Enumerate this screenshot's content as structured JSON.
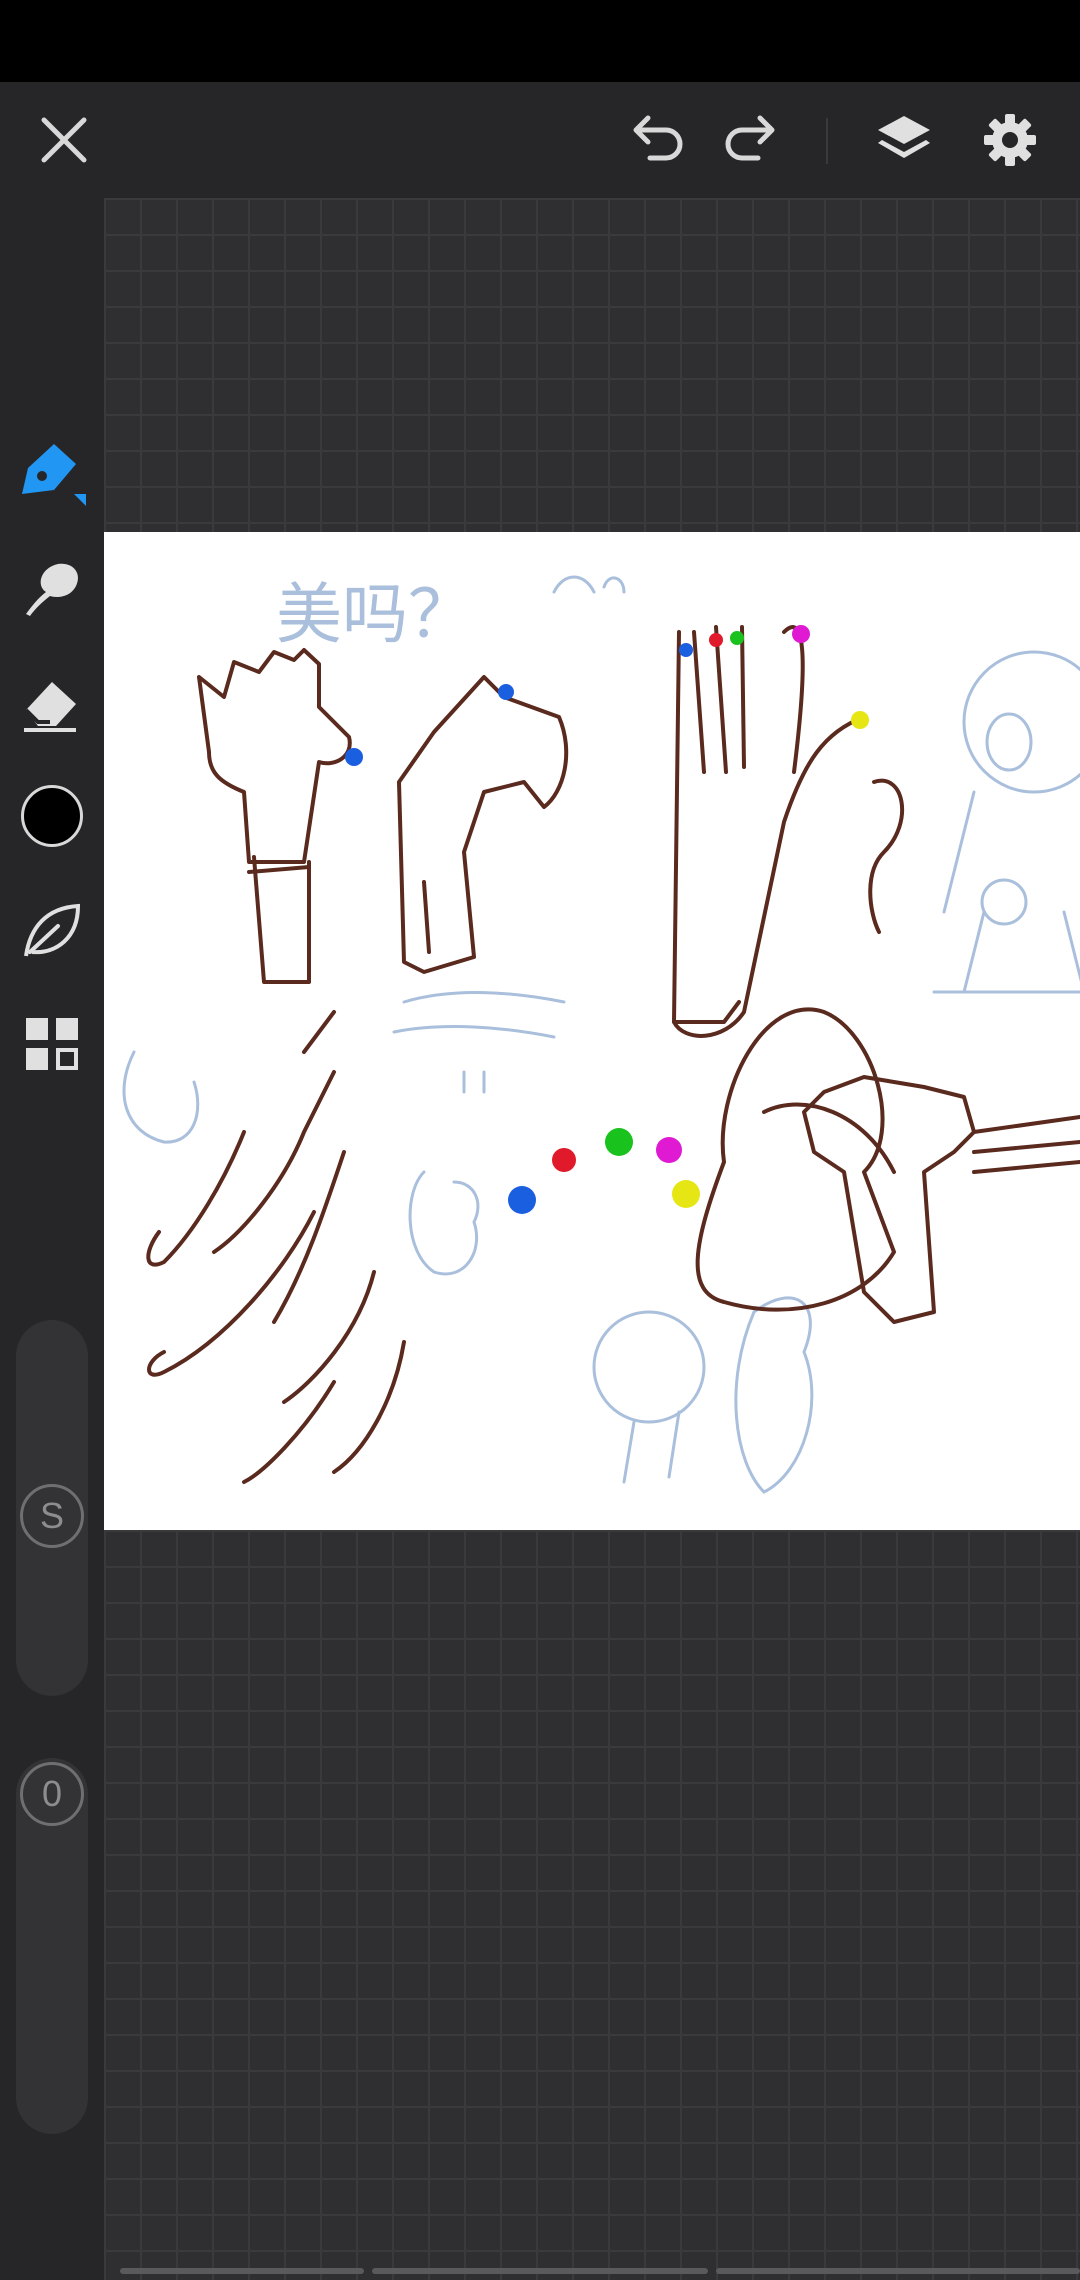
{
  "toolbar": {
    "close_icon": "close-icon",
    "undo_icon": "undo-icon",
    "redo_icon": "redo-icon",
    "layers_icon": "layers-icon",
    "settings_icon": "gear-icon"
  },
  "tools": [
    {
      "name": "pen",
      "icon": "pen-icon",
      "active": true,
      "color": "#2196f3"
    },
    {
      "name": "smudge",
      "icon": "smudge-brush-icon"
    },
    {
      "name": "eraser",
      "icon": "eraser-icon"
    },
    {
      "name": "color",
      "icon": "color-swatch",
      "color": "#000000"
    },
    {
      "name": "brush-library",
      "icon": "leaf-icon"
    },
    {
      "name": "more",
      "icon": "grid-icon"
    }
  ],
  "size_slider": {
    "label": "S"
  },
  "opacity_slider": {
    "label": "0"
  },
  "canvas": {
    "text": "美吗？",
    "stroke_color": "#5b2a1e",
    "sketch_color": "#a9bfdc",
    "gem_colors": [
      "#1a5fe0",
      "#e01a2a",
      "#19c21c",
      "#e01ad3",
      "#e6e614"
    ]
  }
}
